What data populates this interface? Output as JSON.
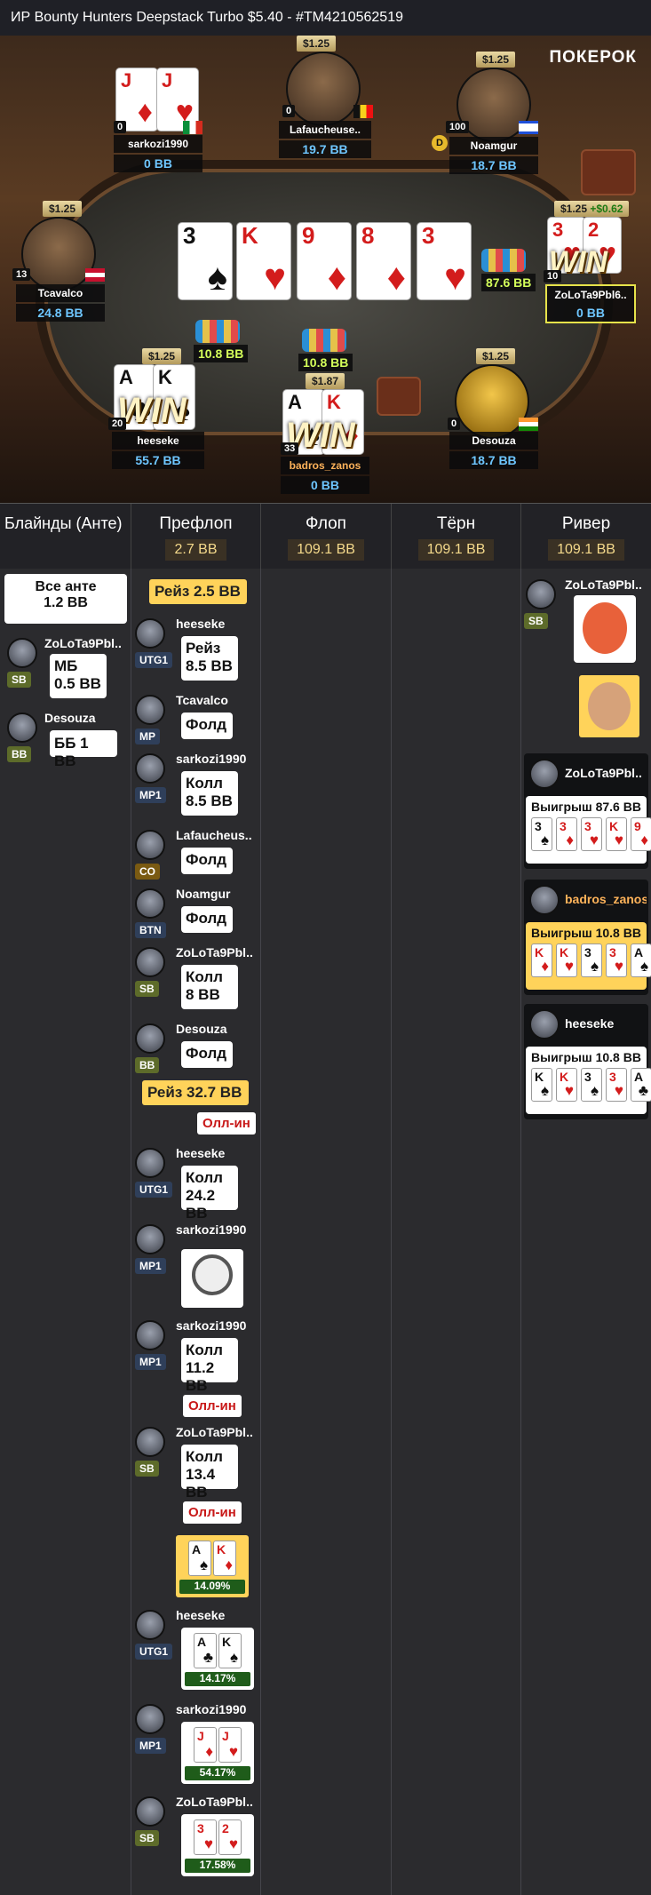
{
  "topbar": {
    "title": "ИР  Bounty Hunters Deepstack Turbo $5.40   - #TM4210562519"
  },
  "logo": "ПОКЕРОК",
  "seats": {
    "sarkozi": {
      "name": "sarkozi1990",
      "bb": "0 BB",
      "count": "0"
    },
    "lafaucheuse": {
      "name": "Lafaucheuse..",
      "bb": "19.7 BB",
      "count": "0",
      "stake": "$1.25"
    },
    "noamgur": {
      "name": "Noamgur",
      "bb": "18.7 BB",
      "count": "100",
      "stake": "$1.25"
    },
    "tcavalco": {
      "name": "Tcavalco",
      "bb": "24.8 BB",
      "count": "13",
      "stake": "$1.25"
    },
    "zolota": {
      "name": "ZoLoTa9Pbl6..",
      "bb": "0 BB",
      "stake": "$1.25",
      "stake2": "+$0.62",
      "count": "10"
    },
    "heeseke": {
      "name": "heeseke",
      "bb": "55.7 BB",
      "count": "20",
      "stake": "$1.25"
    },
    "badros": {
      "name": "badros_zanos",
      "bb": "0 BB",
      "count": "33",
      "stake": "$1.87"
    },
    "desouza": {
      "name": "Desouza",
      "bb": "18.7 BB",
      "count": "0",
      "stake": "$1.25"
    }
  },
  "win_label": "WIN",
  "dealer": "D",
  "board": [
    {
      "rank": "3",
      "suit": "♠",
      "color": "#111111"
    },
    {
      "rank": "K",
      "suit": "♥",
      "color": "#d31c1c"
    },
    {
      "rank": "9",
      "suit": "♦",
      "color": "#d31c1c"
    },
    {
      "rank": "8",
      "suit": "♦",
      "color": "#d31c1c"
    },
    {
      "rank": "3",
      "suit": "♥",
      "color": "#d31c1c"
    }
  ],
  "pots": {
    "right": "87.6 BB",
    "left": "10.8 BB",
    "center": "10.8 BB"
  },
  "headers": {
    "blinds": "Блайнды (Анте)",
    "preflop": "Префлоп",
    "preflop_pot": "2.7 BB",
    "flop": "Флоп",
    "flop_pot": "109.1 BB",
    "turn": "Тёрн",
    "turn_pot": "109.1 BB",
    "river": "Ривер",
    "river_pot": "109.1 BB"
  },
  "blinds_col": {
    "ante_title": "Все анте",
    "ante_value": "1.2 BB",
    "sb_name": "ZoLoTa9Pbl..",
    "sb_pos": "SB",
    "sb_action": "МБ",
    "sb_value": "0.5 BB",
    "bb_name": "Desouza",
    "bb_pos": "BB",
    "bb_action": "ББ 1 BB"
  },
  "preflop": {
    "raise1": "Рейз 2.5 BB",
    "a1": {
      "name": "heeseke",
      "pos": "UTG1",
      "act": "Рейз",
      "val": "8.5 BB"
    },
    "a2": {
      "name": "Tcavalco",
      "pos": "MP",
      "act": "Фолд"
    },
    "a3": {
      "name": "sarkozi1990",
      "pos": "MP1",
      "act": "Колл",
      "val": "8.5 BB"
    },
    "a4": {
      "name": "Lafaucheus..",
      "pos": "CO",
      "act": "Фолд"
    },
    "a5": {
      "name": "Noamgur",
      "pos": "BTN",
      "act": "Фолд"
    },
    "a6": {
      "name": "ZoLoTa9Pbl..",
      "pos": "SB",
      "act": "Колл",
      "val": "8 BB"
    },
    "a7": {
      "name": "Desouza",
      "pos": "BB",
      "act": "Фолд"
    },
    "raise2": "Рейз 32.7 BB",
    "allin1": "Олл-ин",
    "a8": {
      "name": "heeseke",
      "pos": "UTG1",
      "act": "Колл",
      "val": "24.2 BB"
    },
    "a9": {
      "name": "sarkozi1990",
      "pos": "MP1"
    },
    "a10": {
      "name": "sarkozi1990",
      "pos": "MP1",
      "act": "Колл",
      "val": "11.2 BB"
    },
    "allin2": "Олл-ин",
    "a11": {
      "name": "ZoLoTa9Pbl..",
      "pos": "SB",
      "act": "Колл",
      "val": "13.4 BB"
    },
    "allin3": "Олл-ин",
    "hero_eq": "14.09%",
    "e1": {
      "name": "heeseke",
      "pos": "UTG1",
      "eq": "14.17%"
    },
    "e2": {
      "name": "sarkozi1990",
      "pos": "MP1",
      "eq": "54.17%"
    },
    "e3": {
      "name": "ZoLoTa9Pbl..",
      "pos": "SB",
      "eq": "17.58%"
    }
  },
  "river": {
    "p1": {
      "name": "ZoLoTa9Pbl..",
      "pos": "SB"
    },
    "w1": {
      "name": "ZoLoTa9Pbl..",
      "win": "Выигрыш 87.6 BB"
    },
    "w2": {
      "name": "badros_zanos",
      "win": "Выигрыш 10.8 BB"
    },
    "w3": {
      "name": "heeseke",
      "win": "Выигрыш 10.8 BB"
    }
  }
}
